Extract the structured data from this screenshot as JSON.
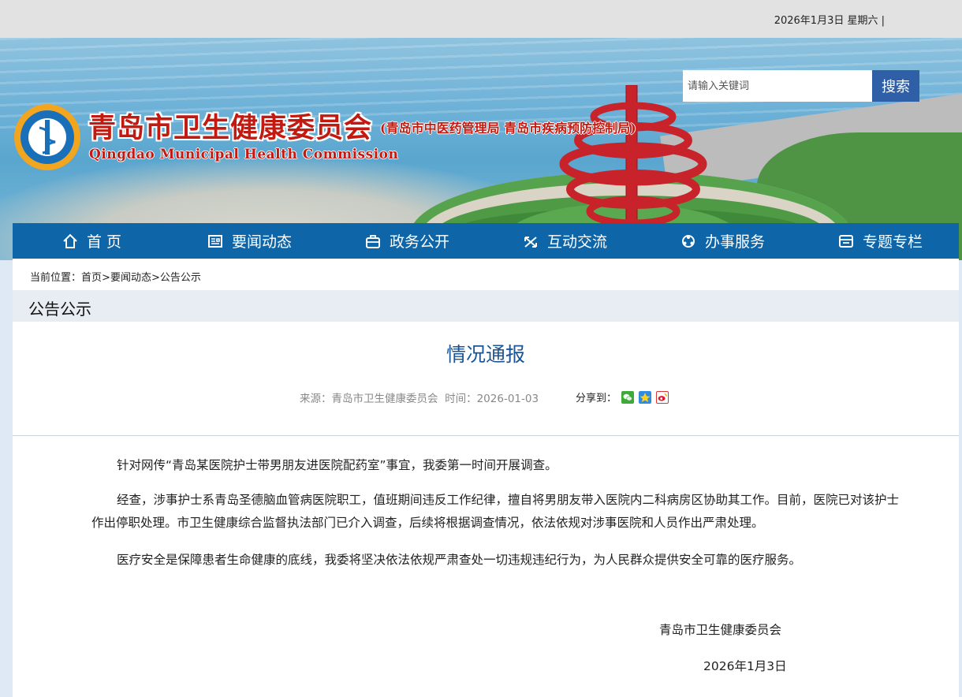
{
  "topbar": {
    "date": "2026年1月3日 星期六 |"
  },
  "header": {
    "title": "青岛市卫生健康委员会",
    "subtitle": "(青岛市中医药管理局 青岛市疾病预防控制局)",
    "english_title": "Qingdao Municipal Health Commission"
  },
  "search": {
    "placeholder": "请输入关键词",
    "value": "",
    "button_label": "搜索"
  },
  "nav": {
    "items": [
      {
        "label": "首 页",
        "icon": "home-icon"
      },
      {
        "label": "要闻动态",
        "icon": "news-icon"
      },
      {
        "label": "政务公开",
        "icon": "briefcase-icon"
      },
      {
        "label": "互动交流",
        "icon": "exchange-icon"
      },
      {
        "label": "办事服务",
        "icon": "service-icon"
      },
      {
        "label": "专题专栏",
        "icon": "column-icon"
      }
    ]
  },
  "breadcrumb": {
    "prefix": "当前位置：",
    "items": [
      "首页",
      "要闻动态",
      "公告公示"
    ],
    "separator": ">"
  },
  "section": {
    "title": "公告公示"
  },
  "article": {
    "title": "情况通报",
    "source_label": "来源：",
    "source": "青岛市卫生健康委员会",
    "time_label": "时间：",
    "time": "2026-01-03",
    "share_label": "分享到：",
    "share_icons": [
      "wechat-icon",
      "qzone-icon",
      "weibo-icon"
    ],
    "paragraphs": [
      "针对网传“青岛某医院护士带男朋友进医院配药室”事宜，我委第一时间开展调查。",
      "经查，涉事护士系青岛圣德脑血管病医院职工，值班期间违反工作纪律，擅自将男朋友带入医院内二科病房区协助其工作。目前，医院已对该护士作出停职处理。市卫生健康综合监督执法部门已介入调查，后续将根据调查情况，依法依规对涉事医院和人员作出严肃处理。",
      "医疗安全是保障患者生命健康的底线，我委将坚决依法依规严肃查处一切违规违纪行为，为人民群众提供安全可靠的医疗服务。"
    ],
    "signature": "青岛市卫生健康委员会",
    "signature_date": "2026年1月3日"
  },
  "colors": {
    "nav_bg": "#0e65a8",
    "title_red": "#c21a10",
    "article_title": "#1c5596",
    "search_button": "#2f5fa6"
  }
}
